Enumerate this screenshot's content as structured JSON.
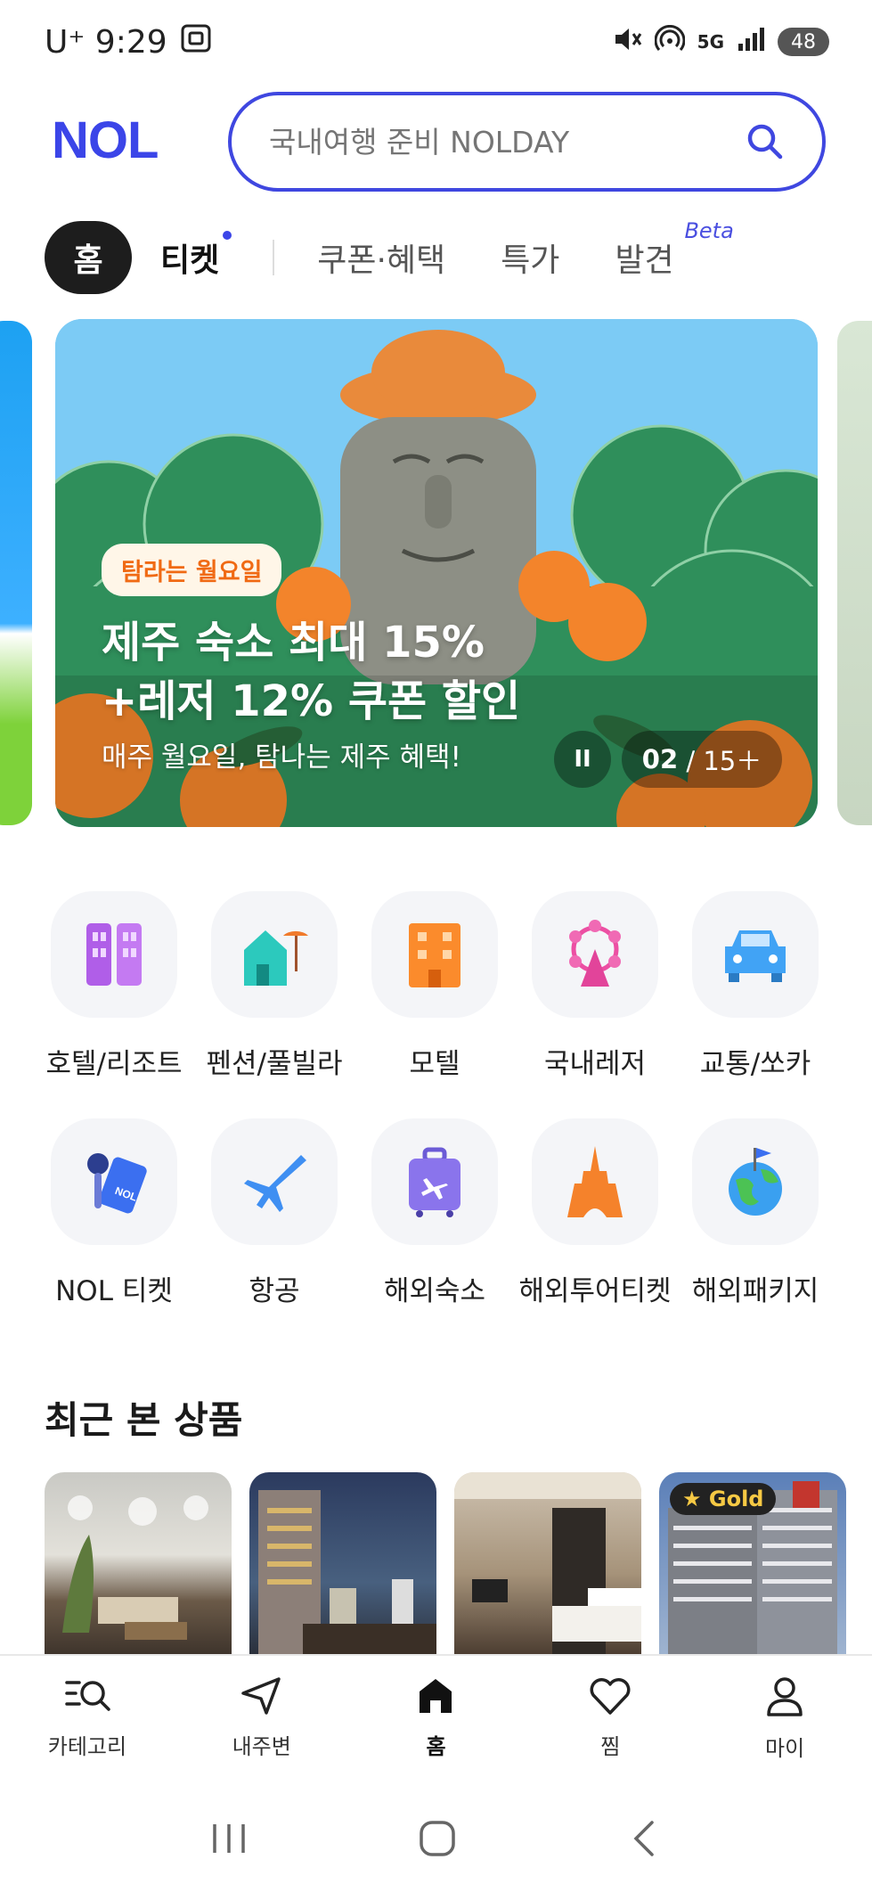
{
  "status_bar": {
    "carrier_time": "U⁺ 9:29",
    "network": "5G",
    "battery": "48"
  },
  "header": {
    "logo": "NOL",
    "search_placeholder": "국내여행 준비 NOLDAY"
  },
  "tabs": [
    {
      "label": "홈",
      "active": true
    },
    {
      "label": "티켓",
      "has_dot": true
    },
    {
      "label": "쿠폰·혜택"
    },
    {
      "label": "특가"
    },
    {
      "label": "발견",
      "tag": "Beta"
    }
  ],
  "banner": {
    "badge": "탐라는 월요일",
    "title": "제주 숙소 최대 15%\n+레저 12% 쿠폰 할인",
    "subtitle": "매주 월요일, 탐나는 제주 혜택!",
    "pause_label": "II",
    "counter_current": "02",
    "counter_total": "/ 15＋"
  },
  "categories": [
    {
      "label": "호텔/리조트",
      "icon": "hotel-icon"
    },
    {
      "label": "펜션/풀빌라",
      "icon": "pension-icon"
    },
    {
      "label": "모텔",
      "icon": "motel-icon"
    },
    {
      "label": "국내레저",
      "icon": "ferris-wheel-icon"
    },
    {
      "label": "교통/쏘카",
      "icon": "car-icon"
    },
    {
      "label": "NOL 티켓",
      "icon": "ticket-mic-icon"
    },
    {
      "label": "항공",
      "icon": "airplane-icon"
    },
    {
      "label": "해외숙소",
      "icon": "suitcase-icon"
    },
    {
      "label": "해외투어티켓",
      "icon": "eiffel-tower-icon"
    },
    {
      "label": "해외패키지",
      "icon": "globe-icon"
    }
  ],
  "recent": {
    "title": "최근 본 상품",
    "gold_badge": "Gold"
  },
  "bottom_nav": [
    {
      "label": "카테고리",
      "icon": "category-search-icon"
    },
    {
      "label": "내주변",
      "icon": "location-arrow-icon"
    },
    {
      "label": "홈",
      "icon": "home-icon",
      "active": true
    },
    {
      "label": "찜",
      "icon": "heart-icon"
    },
    {
      "label": "마이",
      "icon": "person-icon"
    }
  ],
  "colors": {
    "brand": "#3b45e8",
    "badge_text": "#f06a14",
    "gold": "#f6c944"
  }
}
